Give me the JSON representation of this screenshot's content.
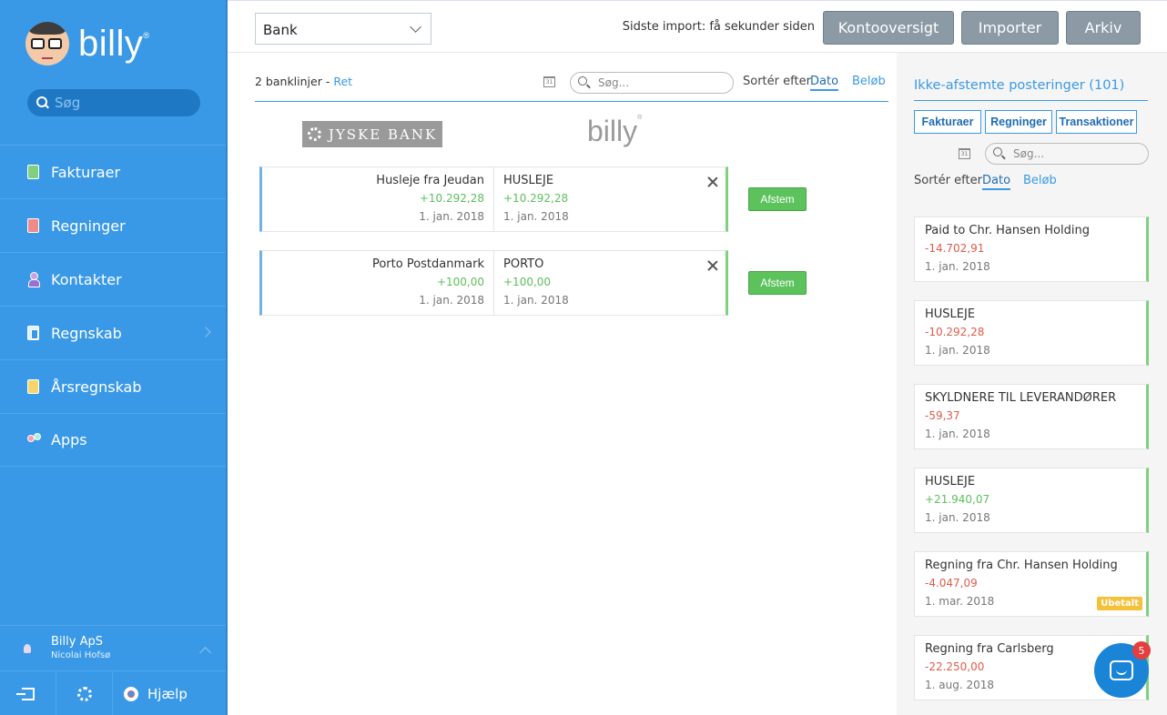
{
  "sidebar": {
    "brand": "billy",
    "brand_mark": "®",
    "search_placeholder": "Søg",
    "items": [
      {
        "label": "Fakturaer",
        "icon": "invoice-icon"
      },
      {
        "label": "Regninger",
        "icon": "bill-icon"
      },
      {
        "label": "Kontakter",
        "icon": "contacts-icon"
      },
      {
        "label": "Regnskab",
        "icon": "accounting-icon"
      },
      {
        "label": "Årsregnskab",
        "icon": "annual-report-icon"
      },
      {
        "label": "Apps",
        "icon": "apps-icon"
      }
    ],
    "company": "Billy ApS",
    "user": "Nicolai Hofsø",
    "help_label": "Hjælp"
  },
  "topbar": {
    "account_value": "Bank",
    "last_import": "Sidste import: få sekunder siden",
    "btn_overview": "Kontooversigt",
    "btn_import": "Importer",
    "btn_archive": "Arkiv"
  },
  "main": {
    "lines_text": "2 banklinjer -",
    "edit_link": "Ret",
    "search_placeholder": "Søg...",
    "sort_label": "Sortér efter",
    "sort_date": "Dato",
    "sort_amount": "Beløb",
    "bank_logo": "JYSKE BANK",
    "billy_logo": "billy",
    "calendar_day": "31",
    "matches": [
      {
        "bank_desc": "Husleje fra Jeudan",
        "bank_amount": "+10.292,28",
        "bank_date": "1. jan. 2018",
        "billy_desc": "HUSLEJE",
        "billy_amount": "+10.292,28",
        "billy_date": "1. jan. 2018",
        "action": "Afstem"
      },
      {
        "bank_desc": "Porto Postdanmark",
        "bank_amount": "+100,00",
        "bank_date": "1. jan. 2018",
        "billy_desc": "PORTO",
        "billy_amount": "+100,00",
        "billy_date": "1. jan. 2018",
        "action": "Afstem"
      }
    ]
  },
  "right": {
    "title": "Ikke-afstemte posteringer (101)",
    "tabs": [
      "Fakturaer",
      "Regninger",
      "Transaktioner"
    ],
    "search_placeholder": "Søg...",
    "sort_label": "Sortér efter",
    "sort_date": "Dato",
    "sort_amount": "Beløb",
    "postings": [
      {
        "desc": "Paid to Chr. Hansen Holding",
        "amount": "-14.702,91",
        "date": "1. jan. 2018",
        "badge": ""
      },
      {
        "desc": "HUSLEJE",
        "amount": "-10.292,28",
        "date": "1. jan. 2018",
        "badge": ""
      },
      {
        "desc": "SKYLDNERE TIL LEVERANDØRER",
        "amount": "-59,37",
        "date": "1. jan. 2018",
        "badge": ""
      },
      {
        "desc": "HUSLEJE",
        "amount": "+21.940,07",
        "date": "1. jan. 2018",
        "badge": ""
      },
      {
        "desc": "Regning fra Chr. Hansen Holding",
        "amount": "-4.047,09",
        "date": "1. mar. 2018",
        "badge": "Ubetalt"
      },
      {
        "desc": "Regning fra Carlsberg",
        "amount": "-22.250,00",
        "date": "1. aug. 2018",
        "badge": ""
      }
    ]
  },
  "chat": {
    "count": "5"
  },
  "colors": {
    "brand_blue": "#3a99e6",
    "positive": "#5cbf5c",
    "negative": "#e05c4b",
    "unpaid": "#f6c13a"
  }
}
